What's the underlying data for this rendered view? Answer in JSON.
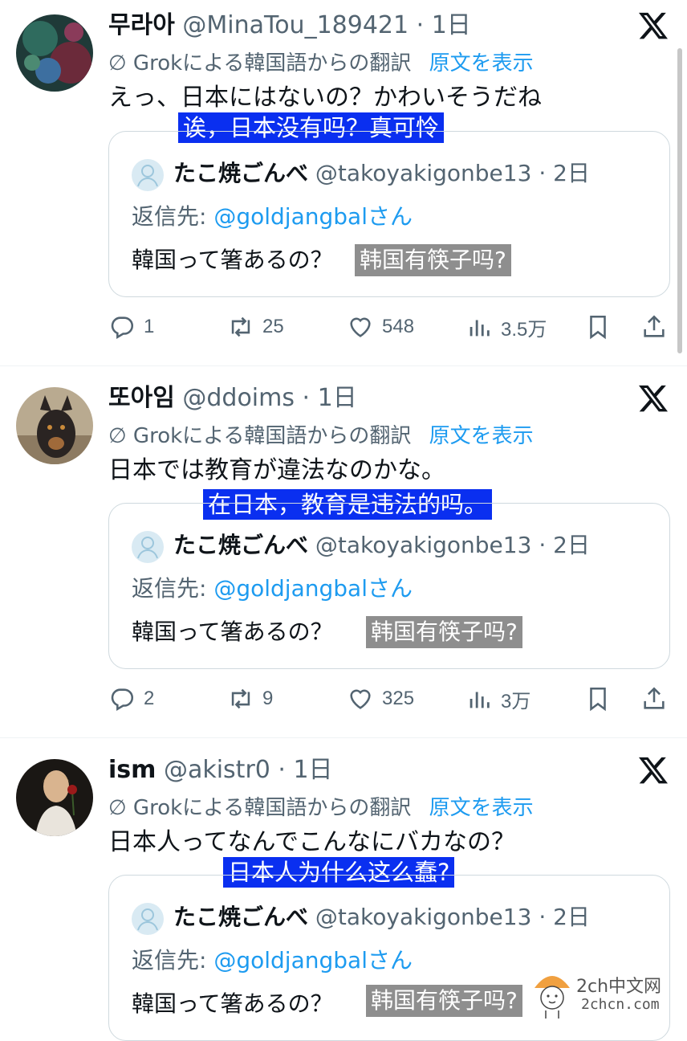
{
  "tweets": [
    {
      "name": "무라아",
      "handle": "@MinaTou_189421",
      "time": "1日",
      "grok_label": "Grokによる韓国語からの翻訳",
      "show_original": "原文を表示",
      "text": "えっ、日本にはないの？かわいそうだね",
      "overlay": "诶，日本没有吗？真可怜",
      "quote": {
        "name": "たこ焼ごんべ",
        "handle": "@takoyakigonbe13",
        "time": "2日",
        "reply_prefix": "返信先:",
        "reply_mention": "@goldjangbal",
        "reply_suffix": "さん",
        "text": "韓国って箸あるの？",
        "overlay": "韩国有筷子吗?"
      },
      "stats": {
        "replies": "1",
        "reposts": "25",
        "likes": "548",
        "views": "3.5万"
      }
    },
    {
      "name": "또아임",
      "handle": "@ddoims",
      "time": "1日",
      "grok_label": "Grokによる韓国語からの翻訳",
      "show_original": "原文を表示",
      "text": "日本では教育が違法なのかな。",
      "overlay": "在日本，教育是违法的吗。",
      "quote": {
        "name": "たこ焼ごんべ",
        "handle": "@takoyakigonbe13",
        "time": "2日",
        "reply_prefix": "返信先:",
        "reply_mention": "@goldjangbal",
        "reply_suffix": "さん",
        "text": "韓国って箸あるの？",
        "overlay": "韩国有筷子吗?"
      },
      "stats": {
        "replies": "2",
        "reposts": "9",
        "likes": "325",
        "views": "3万"
      }
    },
    {
      "name": "ism",
      "handle": "@akistr0",
      "time": "1日",
      "grok_label": "Grokによる韓国語からの翻訳",
      "show_original": "原文を表示",
      "text": "日本人ってなんでこんなにバカなの？",
      "overlay": "日本人为什么这么蠢?",
      "quote": {
        "name": "たこ焼ごんべ",
        "handle": "@takoyakigonbe13",
        "time": "2日",
        "reply_prefix": "返信先:",
        "reply_mention": "@goldjangbal",
        "reply_suffix": "さん",
        "text": "韓国って箸あるの？",
        "overlay": "韩国有筷子吗?"
      }
    }
  ],
  "watermark": {
    "line1": "2ch中文网",
    "line2": "2chcn.com"
  },
  "colors": {
    "link": "#1d9bf0",
    "overlay_blue": "#0a2ff0",
    "overlay_gray": "#8e8e8e",
    "muted": "#536471"
  },
  "icons": [
    "x-logo-icon",
    "translate-icon",
    "reply-icon",
    "repost-icon",
    "like-icon",
    "views-icon",
    "bookmark-icon",
    "share-icon",
    "default-avatar-icon"
  ]
}
